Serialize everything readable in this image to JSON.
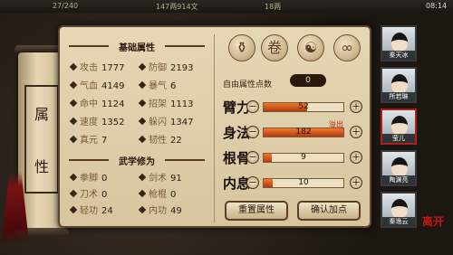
{
  "topbar": {
    "stamina": "27/240",
    "money": "147两914文",
    "gold": "18两",
    "time": "08:14"
  },
  "scroll": {
    "title_chars": [
      "属",
      "性"
    ]
  },
  "basic": {
    "title": "基础属性",
    "stats": [
      {
        "name": "攻击",
        "value": "1777"
      },
      {
        "name": "防御",
        "value": "2193"
      },
      {
        "name": "气血",
        "value": "4149"
      },
      {
        "name": "暴气",
        "value": "6"
      },
      {
        "name": "命中",
        "value": "1124"
      },
      {
        "name": "招架",
        "value": "1113"
      },
      {
        "name": "速度",
        "value": "1352"
      },
      {
        "name": "躲闪",
        "value": "1347"
      },
      {
        "name": "真元",
        "value": "7"
      },
      {
        "name": "韧性",
        "value": "22"
      }
    ]
  },
  "martial": {
    "title": "武学修为",
    "stats": [
      {
        "name": "拳脚",
        "value": "0"
      },
      {
        "name": "剑术",
        "value": "91"
      },
      {
        "name": "刀术",
        "value": "0"
      },
      {
        "name": "枪棍",
        "value": "0"
      },
      {
        "name": "轻功",
        "value": "24"
      },
      {
        "name": "内功",
        "value": "49"
      }
    ]
  },
  "free_points": {
    "label": "自由属性点数",
    "value": "0"
  },
  "attributes": [
    {
      "name": "臂力",
      "value": "52",
      "fill": 0.55
    },
    {
      "name": "身法",
      "value": "182",
      "fill": 1.0,
      "tag": "溢出"
    },
    {
      "name": "根骨",
      "value": "9",
      "fill": 0.1
    },
    {
      "name": "内息",
      "value": "10",
      "fill": 0.11
    }
  ],
  "buttons": {
    "reset": "重置属性",
    "confirm": "确认加点"
  },
  "characters": [
    {
      "name": "秦天冰"
    },
    {
      "name": "所若琳"
    },
    {
      "name": "莹儿"
    },
    {
      "name": "陶渊亮"
    },
    {
      "name": "秦逸云"
    }
  ],
  "seal": "离开",
  "colors": {
    "bar_fill": "#e05a20",
    "accent": "#c01818"
  }
}
